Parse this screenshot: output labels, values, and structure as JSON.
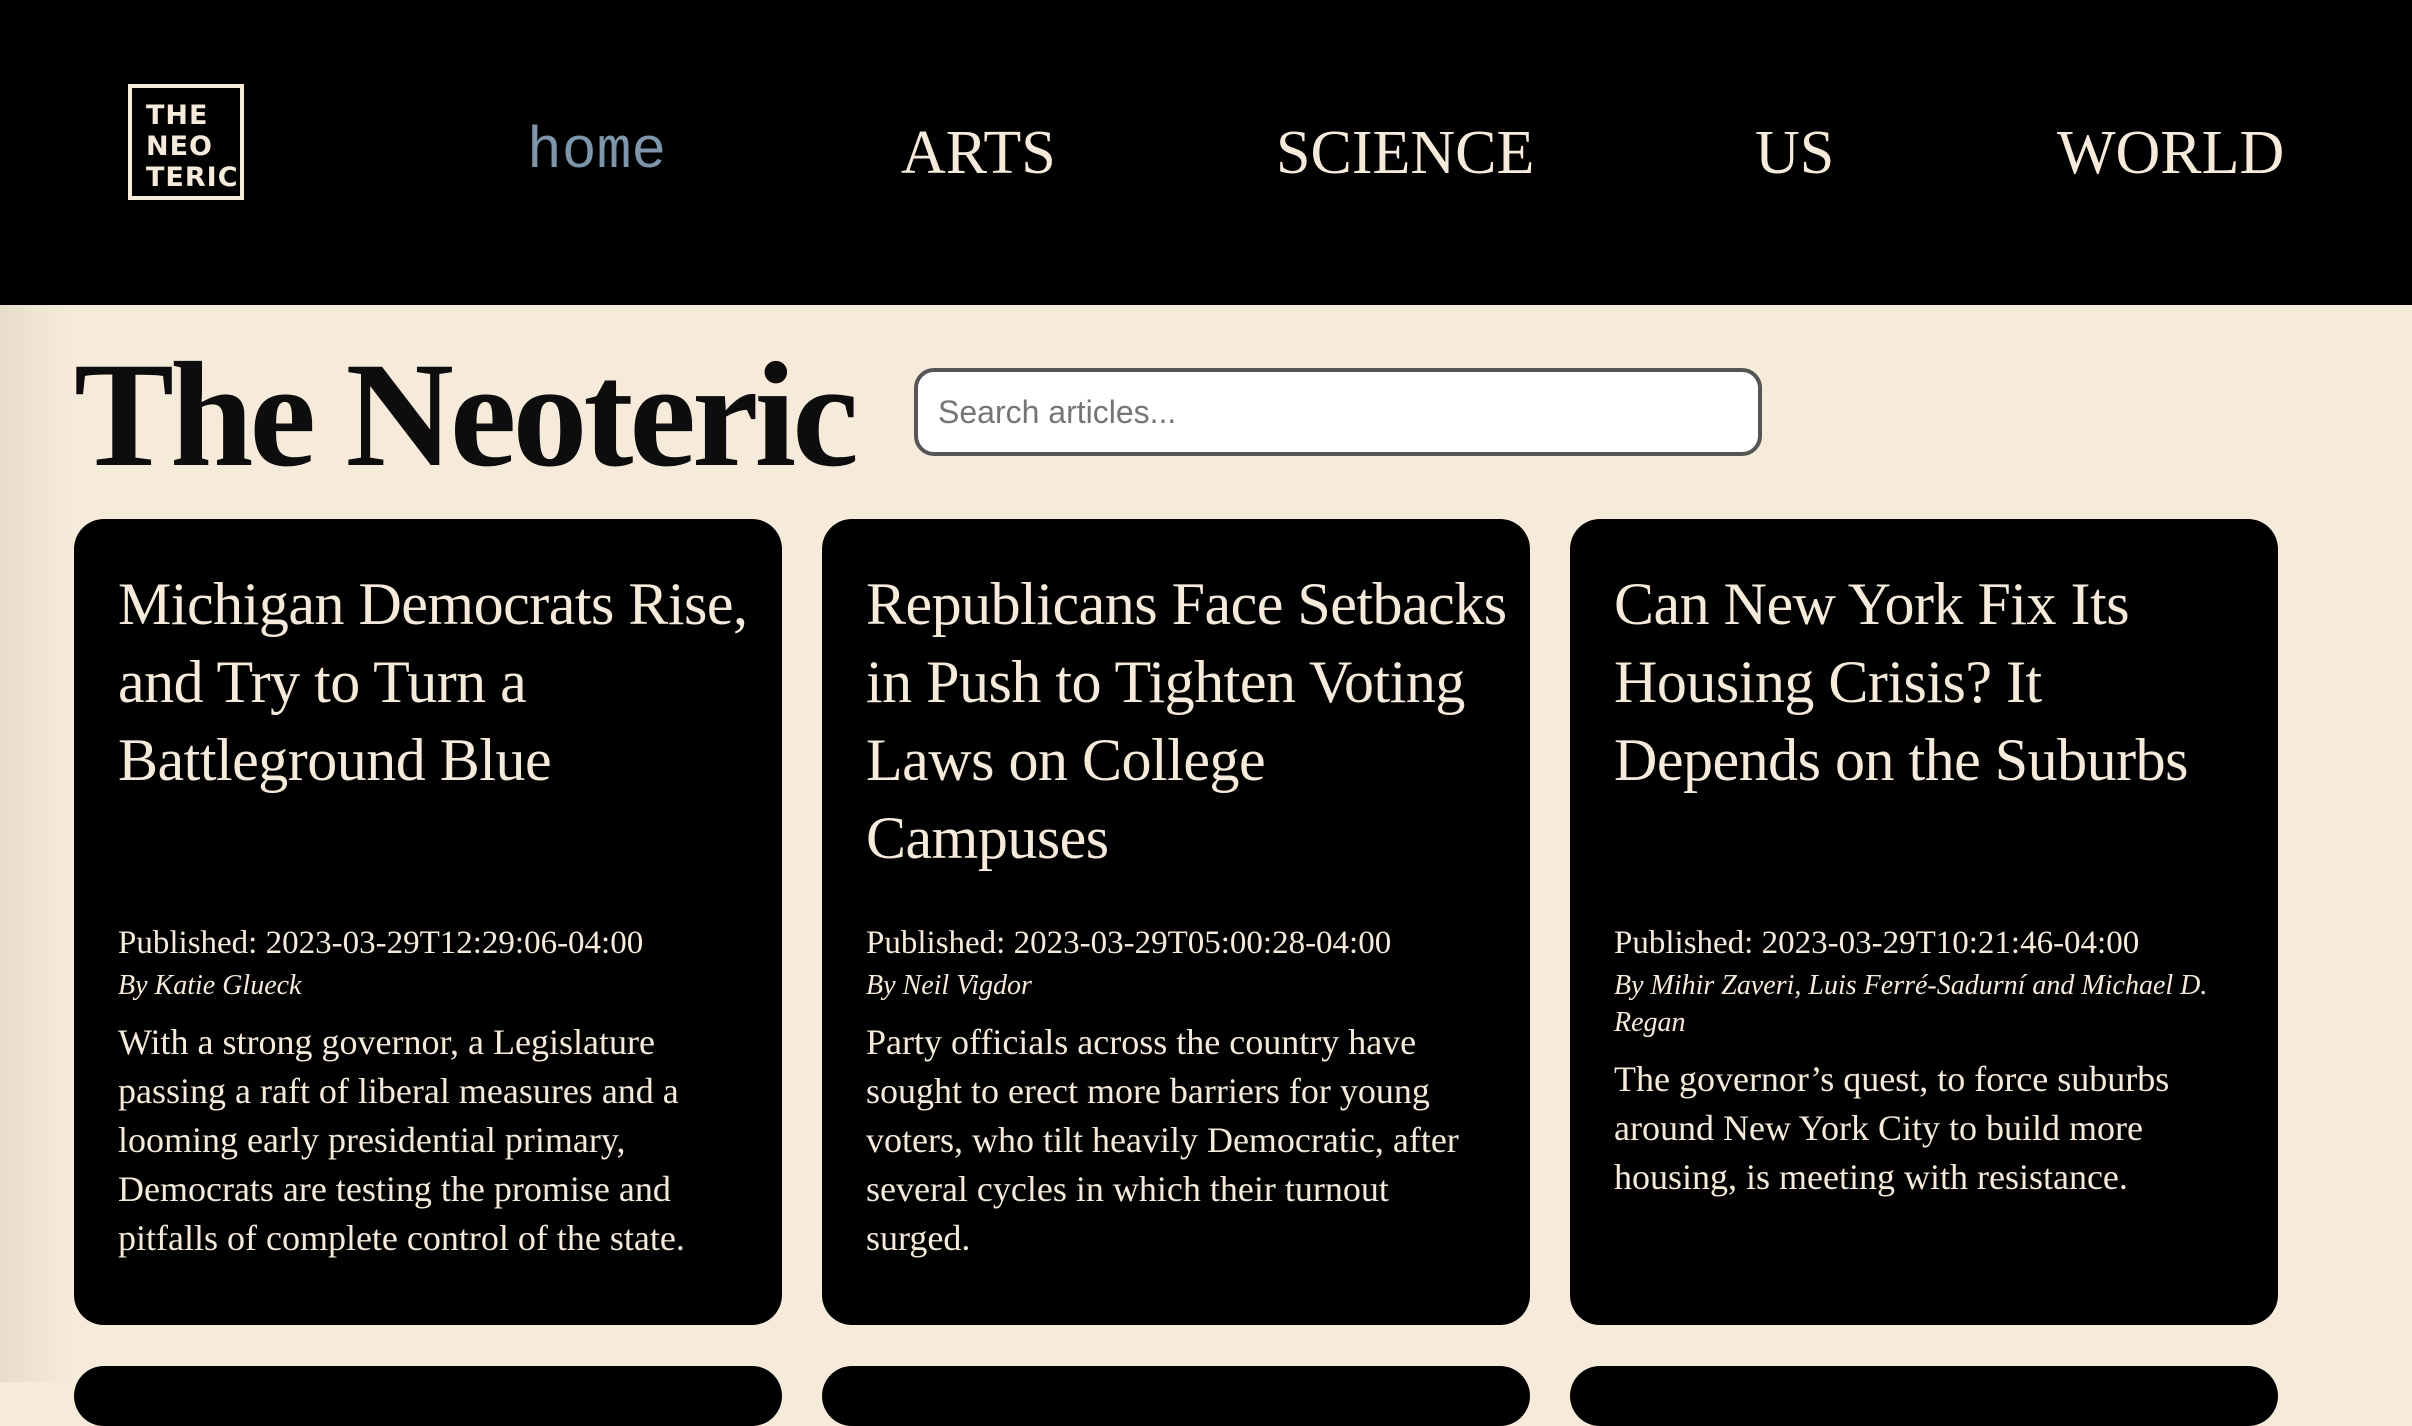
{
  "logo": {
    "lines": [
      "THE",
      "NEO",
      "TERIC"
    ]
  },
  "nav": {
    "items": [
      {
        "label": "home"
      },
      {
        "label": "ARTS"
      },
      {
        "label": "SCIENCE"
      },
      {
        "label": "US"
      },
      {
        "label": "WORLD"
      }
    ]
  },
  "site": {
    "title": "The Neoteric"
  },
  "search": {
    "placeholder": "Search articles..."
  },
  "articles": [
    {
      "title": "Michigan Democrats Rise, and Try to Turn a Battleground Blue",
      "published": "Published: 2023-03-29T12:29:06-04:00",
      "byline": "By Katie Glueck",
      "summary": "With a strong governor, a Legislature passing a raft of liberal measures and a looming early presidential primary, Democrats are testing the promise and pitfalls of complete control of the state."
    },
    {
      "title": "Republicans Face Setbacks in Push to Tighten Voting Laws on College Campuses",
      "published": "Published: 2023-03-29T05:00:28-04:00",
      "byline": "By Neil Vigdor",
      "summary": "Party officials across the country have sought to erect more barriers for young voters, who tilt heavily Democratic, after several cycles in which their turnout surged."
    },
    {
      "title": "Can New York Fix Its Housing Crisis? It Depends on the Suburbs",
      "published": "Published: 2023-03-29T10:21:46-04:00",
      "byline": "By Mihir Zaveri, Luis Ferré-Sadurní and Michael D. Regan",
      "summary": "The governor’s quest, to force suburbs around New York City to build more housing, is meeting with resistance."
    }
  ],
  "colors": {
    "background": "#f6ebdb",
    "header": "#000000",
    "nav_active": "#7d96ac",
    "card": "#000000",
    "card_text": "#f6ebdb"
  }
}
